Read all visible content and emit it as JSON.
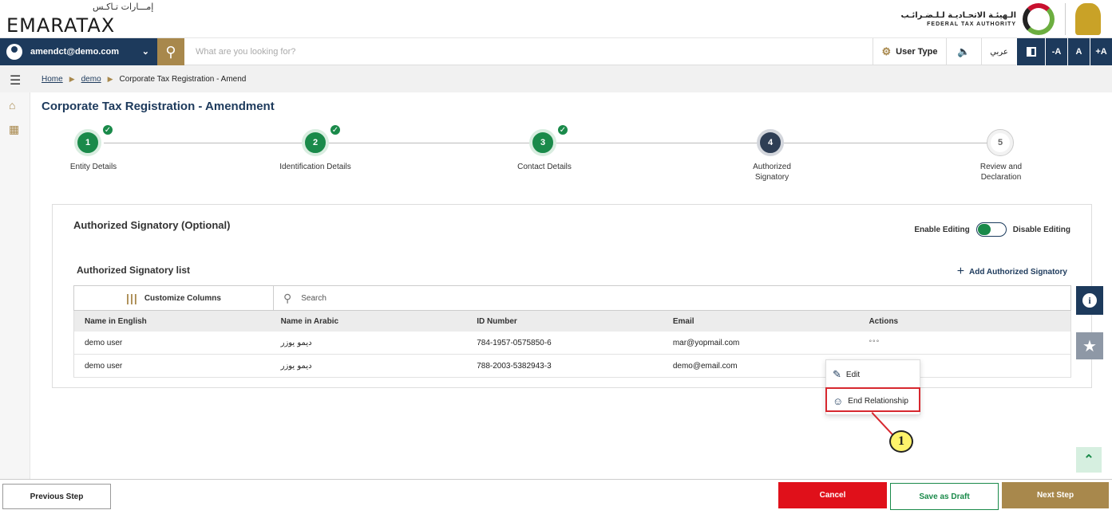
{
  "brand": {
    "logo_ar": "إمـــارات تـاكـس",
    "logo_en": "EMARATAX",
    "authority_ar": "الـهيئـة الاتحـاديـة لـلـضـرائـب",
    "authority_en": "FEDERAL TAX AUTHORITY"
  },
  "navbar": {
    "user_email": "amendct@demo.com",
    "search_placeholder": "What are you looking for?",
    "user_type_label": "User Type",
    "arabic_label": "عربي",
    "font_decrease": "-A",
    "font_normal": "A",
    "font_increase": "+A"
  },
  "breadcrumb": {
    "items": [
      "Home",
      "demo",
      "Corporate Tax Registration - Amend"
    ]
  },
  "page": {
    "title": "Corporate Tax Registration - Amendment"
  },
  "steps": [
    {
      "number": "1",
      "label": "Entity Details",
      "status": "done"
    },
    {
      "number": "2",
      "label": "Identification Details",
      "status": "done"
    },
    {
      "number": "3",
      "label": "Contact Details",
      "status": "done"
    },
    {
      "number": "4",
      "label_line1": "Authorized",
      "label_line2": "Signatory",
      "status": "active"
    },
    {
      "number": "5",
      "label_line1": "Review and",
      "label_line2": "Declaration",
      "status": "todo"
    }
  ],
  "section": {
    "title": "Authorized Signatory (Optional)",
    "enable_editing": "Enable Editing",
    "disable_editing": "Disable Editing",
    "list_title": "Authorized Signatory list",
    "add_button": "Add Authorized Signatory"
  },
  "table": {
    "customize_columns": "Customize Columns",
    "search_label": "Search",
    "columns": [
      "Name in English",
      "Name in Arabic",
      "ID Number",
      "Email",
      "Actions"
    ],
    "rows": [
      {
        "name_en": "demo user",
        "name_ar": "ديمو يوزر",
        "id_number": "784-1957-0575850-6",
        "email": "mar@yopmail.com",
        "actions": "°°°"
      },
      {
        "name_en": "demo user",
        "name_ar": "ديمو يوزر",
        "id_number": "788-2003-5382943-3",
        "email": "demo@email.com",
        "actions": ""
      }
    ]
  },
  "context_menu": {
    "edit": "Edit",
    "end_relationship": "End Relationship"
  },
  "annotation": {
    "callout_number": "1"
  },
  "footer": {
    "previous": "Previous Step",
    "cancel": "Cancel",
    "save_draft": "Save as Draft",
    "next": "Next Step"
  },
  "colors": {
    "navy": "#1d3a5c",
    "gold": "#a8884c",
    "green": "#1a8a4a",
    "red": "#e0101a"
  }
}
